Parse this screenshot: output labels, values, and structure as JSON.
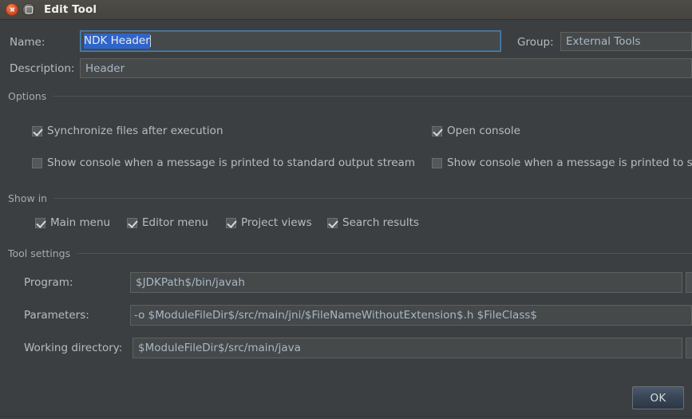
{
  "window": {
    "title": "Edit Tool",
    "controls": [
      {
        "name": "close",
        "icon": "close-icon"
      },
      {
        "name": "maximize",
        "icon": "maximize-icon"
      }
    ]
  },
  "colors": {
    "background": "#3c3f41",
    "titlebar": "#46443f",
    "field_background": "#45494a",
    "field_border": "#5e6060",
    "text": "#bbbbbb",
    "field_text": "#a9b7c6",
    "selection": "#2f65ca",
    "focus_border": "#4b7fae",
    "accent_ok": "#394656",
    "separator": "#4f5254"
  },
  "form": {
    "name_label": "Name:",
    "name_value": "NDK Header",
    "name_placeholder": "",
    "group_label": "Group:",
    "group_value": "External Tools",
    "description_label": "Description:",
    "description_value": "Header",
    "description_placeholder": ""
  },
  "options": {
    "title": "Options",
    "checkboxes": [
      {
        "label": "Synchronize files after execution",
        "checked": true,
        "column": "left"
      },
      {
        "label": "Open console",
        "checked": true,
        "column": "right"
      },
      {
        "label": "Show console when a message is printed to standard output stream",
        "checked": false,
        "column": "left"
      },
      {
        "label": "Show console when a message is printed to s",
        "checked": false,
        "column": "right"
      }
    ]
  },
  "show_in": {
    "title": "Show in",
    "checkboxes": [
      {
        "label": "Main menu",
        "checked": true
      },
      {
        "label": "Editor menu",
        "checked": true
      },
      {
        "label": "Project views",
        "checked": true
      },
      {
        "label": "Search results",
        "checked": true
      }
    ]
  },
  "tool_settings": {
    "title": "Tool settings",
    "rows": [
      {
        "label": "Program:",
        "value": "$JDKPath$/bin/javah",
        "browse": "..."
      },
      {
        "label": "Parameters:",
        "value": "-o $ModuleFileDir$/src/main/jni/$FileNameWithoutExtension$.h $FileClass$",
        "browse": ""
      },
      {
        "label": "Working directory:",
        "value": "$ModuleFileDir$/src/main/java",
        "browse": "..."
      }
    ]
  },
  "buttons": {
    "ok": "OK"
  }
}
